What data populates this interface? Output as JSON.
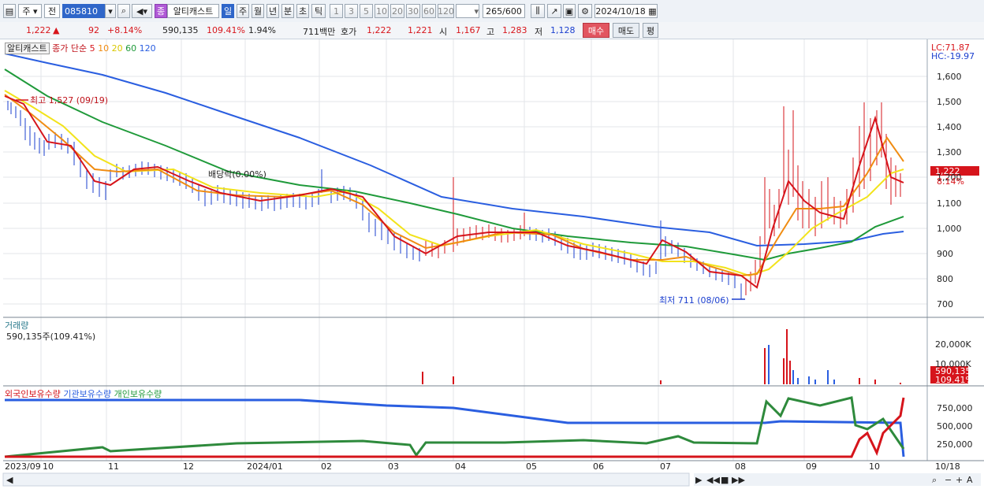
{
  "toolbar": {
    "market_type": "주",
    "market_sel": "전",
    "stock_code": "085810",
    "stock_badge": "종",
    "stock_name": "알티캐스트",
    "periods": [
      "일",
      "주",
      "월",
      "년",
      "분",
      "초",
      "틱"
    ],
    "minutes": [
      "1",
      "3",
      "5",
      "10",
      "20",
      "30",
      "60",
      "120"
    ],
    "count": "265",
    "count_total": "/600",
    "date": "2024/10/18"
  },
  "quote": {
    "price": "1,222",
    "change_arrow": "▲",
    "change": "92",
    "change_pct": "+8.14%",
    "volume": "590,135",
    "volume_ratio": "109.41%",
    "turnover_pct": "1.94%",
    "amount": "711백만",
    "ask_label": "호가",
    "ask1": "1,222",
    "ask2": "1,221",
    "open_label": "시",
    "open": "1,167",
    "high_label": "고",
    "high": "1,283",
    "low_label": "저",
    "low": "1,128",
    "buy_btn": "매수",
    "sell_btn": "매도",
    "eval_btn": "평"
  },
  "price_panel": {
    "title": "알티캐스트",
    "ma_label": "종가 단순",
    "ma_periods": [
      "5",
      "10",
      "20",
      "60",
      "120"
    ],
    "ma_colors": [
      "#d6141b",
      "#f08c12",
      "#f2e31b",
      "#1f9a3a",
      "#2a5ee0"
    ],
    "lc": "LC:71.87",
    "hc": "HC:-19.97",
    "y_ticks": [
      "1,600",
      "1,500",
      "1,400",
      "1,300",
      "1,200",
      "1,100",
      "1,000",
      "900",
      "800",
      "700"
    ],
    "current_price_tag": "1,222",
    "current_pct_tag": "8.14%",
    "high_annotation": "최고 1,527 (09/19)",
    "low_annotation": "최저 711 (08/06)",
    "dividend_annotation": "배당락(0.00%)"
  },
  "volume_panel": {
    "title": "거래량",
    "value": "590,135주(109.41%)",
    "y_ticks": [
      "20,000K",
      "10,000K"
    ],
    "tag_value": "590,135",
    "tag_pct": "109.41%"
  },
  "holders_panel": {
    "legend": [
      "외국인보유수량",
      "기관보유수량",
      "개인보유수량"
    ],
    "legend_colors": [
      "#d6141b",
      "#2a5ee0",
      "#1f9a3a"
    ],
    "y_ticks": [
      "750,000",
      "500,000",
      "250,000"
    ]
  },
  "x_axis": [
    "2023/09",
    "10",
    "11",
    "12",
    "2024/01",
    "02",
    "03",
    "04",
    "05",
    "06",
    "07",
    "08",
    "09",
    "10"
  ],
  "x_axis_end": "10/18"
}
